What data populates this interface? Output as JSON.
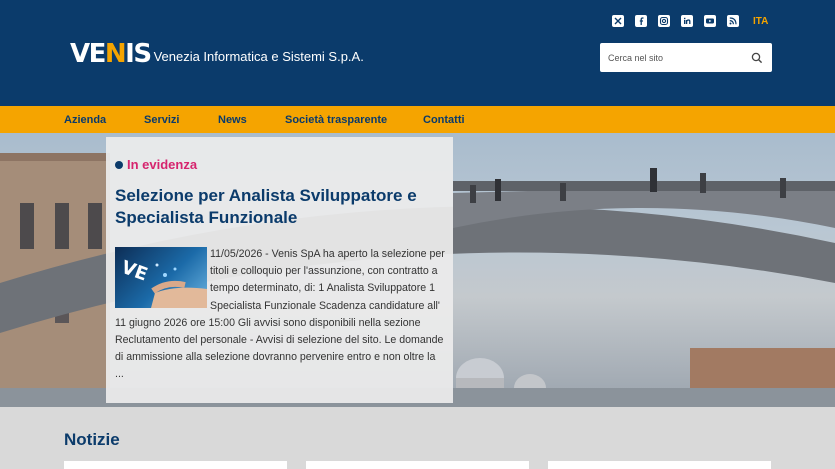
{
  "header": {
    "logo_mark": "VE",
    "logo_mark_n": "N",
    "logo_mark_end": "IS",
    "logo_text": "Venezia Informatica e Sistemi S.p.A.",
    "social_icons": [
      "x-icon",
      "facebook-icon",
      "instagram-icon",
      "linkedin-icon",
      "youtube-icon",
      "rss-icon"
    ],
    "language": "ITA",
    "search_placeholder": "Cerca nel sito"
  },
  "nav": {
    "items": [
      "Azienda",
      "Servizi",
      "News",
      "Società trasparente",
      "Contatti"
    ]
  },
  "featured": {
    "badge": "In evidenza",
    "title": "Selezione per Analista Sviluppatore e Specialista Funzionale",
    "excerpt": "11/05/2026 - Venis SpA ha aperto la selezione per titoli e colloquio per l'assunzione, con contratto a tempo determinato, di: 1 Analista Sviluppatore 1 Specialista Funzionale Scadenza candidature all' 11 giugno 2026 ore 15:00 Gli avvisi sono disponibili nella sezione Reclutamento del personale - Avvisi di selezione del sito. Le domande di ammissione alla selezione dovranno pervenire entro e non oltre la ..."
  },
  "notizie": {
    "title": "Notizie"
  },
  "colors": {
    "header_blue": "#0b3b6b",
    "accent_orange": "#f5a400",
    "badge_pink": "#d6246e"
  }
}
